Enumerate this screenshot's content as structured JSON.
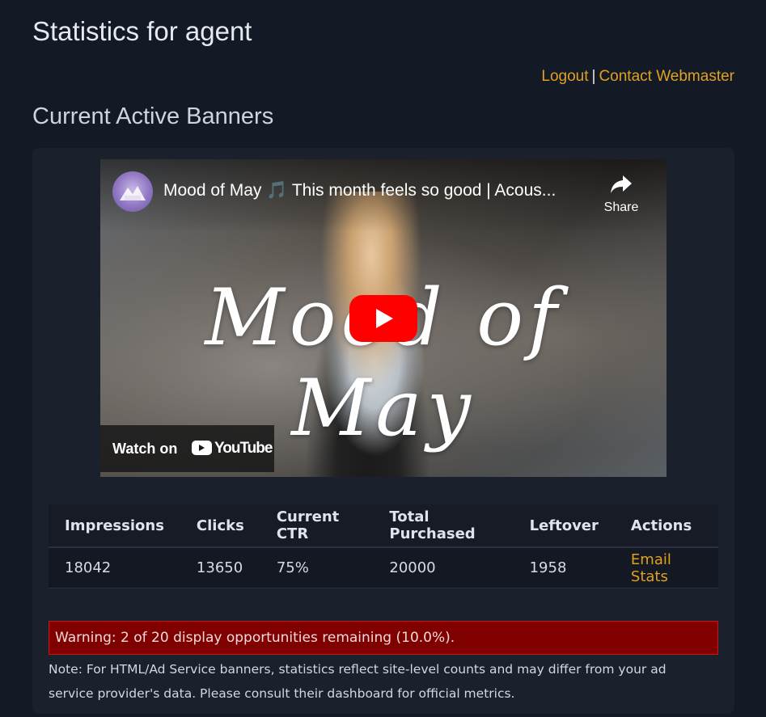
{
  "header": {
    "title": "Statistics for agent",
    "logout_label": "Logout",
    "separator": "|",
    "contact_label": "Contact Webmaster"
  },
  "section": {
    "title": "Current Active Banners"
  },
  "video": {
    "title": "Mood of May 🎵 This month feels so good | Acous...",
    "share_label": "Share",
    "overlay_text": "Mood of May",
    "watch_on_label": "Watch on",
    "youtube_label": "YouTube"
  },
  "stats": {
    "headers": [
      "Impressions",
      "Clicks",
      "Current CTR",
      "Total Purchased",
      "Leftover",
      "Actions"
    ],
    "row": {
      "impressions": "18042",
      "clicks": "13650",
      "ctr": "75%",
      "total_purchased": "20000",
      "leftover": "1958",
      "action_label": "Email Stats"
    }
  },
  "warning": {
    "text": "Warning: 2 of 20 display opportunities remaining (10.0%)."
  },
  "note": {
    "text": "Note: For HTML/Ad Service banners, statistics reflect site-level counts and may differ from your ad service provider's data. Please consult their dashboard for official metrics."
  },
  "colors": {
    "background": "#131a26",
    "card": "#1a202c",
    "link": "#e0a020",
    "warning_bg": "#800000",
    "warning_border": "#d11212"
  }
}
